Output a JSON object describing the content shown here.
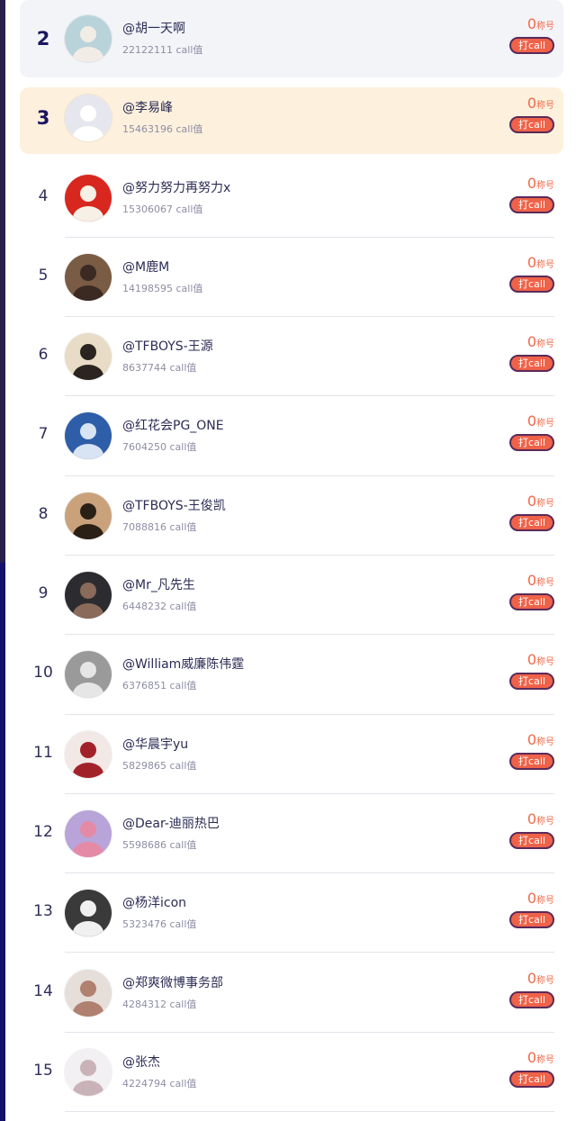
{
  "entries": [
    {
      "rank": "2",
      "name": "@胡一天啊",
      "score": "22122111 call值",
      "votes": "0",
      "unit": "称号",
      "button": "打call",
      "highlight": "gray",
      "avatar_bg": "#b9d3da",
      "avatar_fg": "#f2ece6"
    },
    {
      "rank": "3",
      "name": "@李易峰",
      "score": "15463196 call值",
      "votes": "0",
      "unit": "称号",
      "button": "打call",
      "highlight": "yellow",
      "avatar_bg": "#e6e7ee",
      "avatar_fg": "#ffffff"
    },
    {
      "rank": "4",
      "name": "@努力努力再努力x",
      "score": "15306067 call值",
      "votes": "0",
      "unit": "称号",
      "button": "打call",
      "highlight": "",
      "avatar_bg": "#d8271f",
      "avatar_fg": "#f6f0e6"
    },
    {
      "rank": "5",
      "name": "@M鹿M",
      "score": "14198595 call值",
      "votes": "0",
      "unit": "称号",
      "button": "打call",
      "highlight": "",
      "avatar_bg": "#7a5b44",
      "avatar_fg": "#3a2a22"
    },
    {
      "rank": "6",
      "name": "@TFBOYS-王源",
      "score": "8637744 call值",
      "votes": "0",
      "unit": "称号",
      "button": "打call",
      "highlight": "",
      "avatar_bg": "#e8dcc6",
      "avatar_fg": "#2b2420"
    },
    {
      "rank": "7",
      "name": "@红花会PG_ONE",
      "score": "7604250 call值",
      "votes": "0",
      "unit": "称号",
      "button": "打call",
      "highlight": "",
      "avatar_bg": "#2e5ea8",
      "avatar_fg": "#d8e4f4"
    },
    {
      "rank": "8",
      "name": "@TFBOYS-王俊凯",
      "score": "7088816 call值",
      "votes": "0",
      "unit": "称号",
      "button": "打call",
      "highlight": "",
      "avatar_bg": "#c9a27c",
      "avatar_fg": "#2b2016"
    },
    {
      "rank": "9",
      "name": "@Mr_凡先生",
      "score": "6448232 call值",
      "votes": "0",
      "unit": "称号",
      "button": "打call",
      "highlight": "",
      "avatar_bg": "#2c2c30",
      "avatar_fg": "#8a6a5a"
    },
    {
      "rank": "10",
      "name": "@William威廉陈伟霆",
      "score": "6376851 call值",
      "votes": "0",
      "unit": "称号",
      "button": "打call",
      "highlight": "",
      "avatar_bg": "#9a9a9a",
      "avatar_fg": "#e6e6e6"
    },
    {
      "rank": "11",
      "name": "@华晨宇yu",
      "score": "5829865 call值",
      "votes": "0",
      "unit": "称号",
      "button": "打call",
      "highlight": "",
      "avatar_bg": "#f2e8e6",
      "avatar_fg": "#a2222a"
    },
    {
      "rank": "12",
      "name": "@Dear-迪丽热巴",
      "score": "5598686 call值",
      "votes": "0",
      "unit": "称号",
      "button": "打call",
      "highlight": "",
      "avatar_bg": "#b8a4d8",
      "avatar_fg": "#e48aa6"
    },
    {
      "rank": "13",
      "name": "@杨洋icon",
      "score": "5323476 call值",
      "votes": "0",
      "unit": "称号",
      "button": "打call",
      "highlight": "",
      "avatar_bg": "#3a3a3a",
      "avatar_fg": "#f0f0f0"
    },
    {
      "rank": "14",
      "name": "@郑爽微博事务部",
      "score": "4284312 call值",
      "votes": "0",
      "unit": "称号",
      "button": "打call",
      "highlight": "",
      "avatar_bg": "#e6ded8",
      "avatar_fg": "#b08070"
    },
    {
      "rank": "15",
      "name": "@张杰",
      "score": "4224794 call值",
      "votes": "0",
      "unit": "称号",
      "button": "打call",
      "highlight": "",
      "avatar_bg": "#f2f0f2",
      "avatar_fg": "#c9b2b8"
    }
  ],
  "colors": {
    "accent": "#f06a4a",
    "button_bg": "#f06248",
    "button_border": "#5a2a5a",
    "highlight_gray": "#f3f4f8",
    "highlight_yellow": "#fdf1dd",
    "name_text": "#2b2b55",
    "score_text": "#8d8da5"
  }
}
